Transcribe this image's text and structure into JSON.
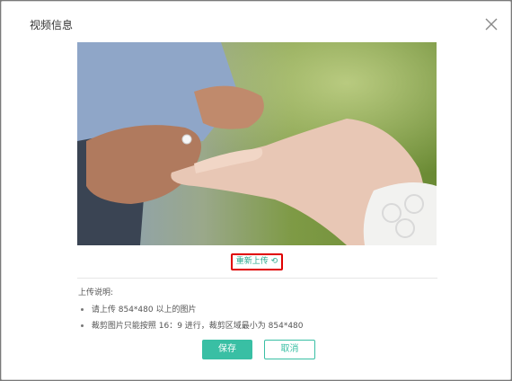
{
  "dialog": {
    "title": "视频信息",
    "close_icon": "close-icon",
    "image_alt_description_icon": "video-cover-image",
    "reupload_label": "重新上传",
    "reupload_icon": "refresh-icon",
    "notes_title": "上传说明:",
    "notes": [
      "请上传 854*480 以上的图片",
      "裁剪图片只能按照 16：9 进行，裁剪区域最小为 854*480"
    ],
    "save_label": "保存",
    "cancel_label": "取消"
  },
  "colors": {
    "accent": "#39bfa4",
    "highlight_border": "#e00000",
    "overlay": "#7a7a7a"
  }
}
